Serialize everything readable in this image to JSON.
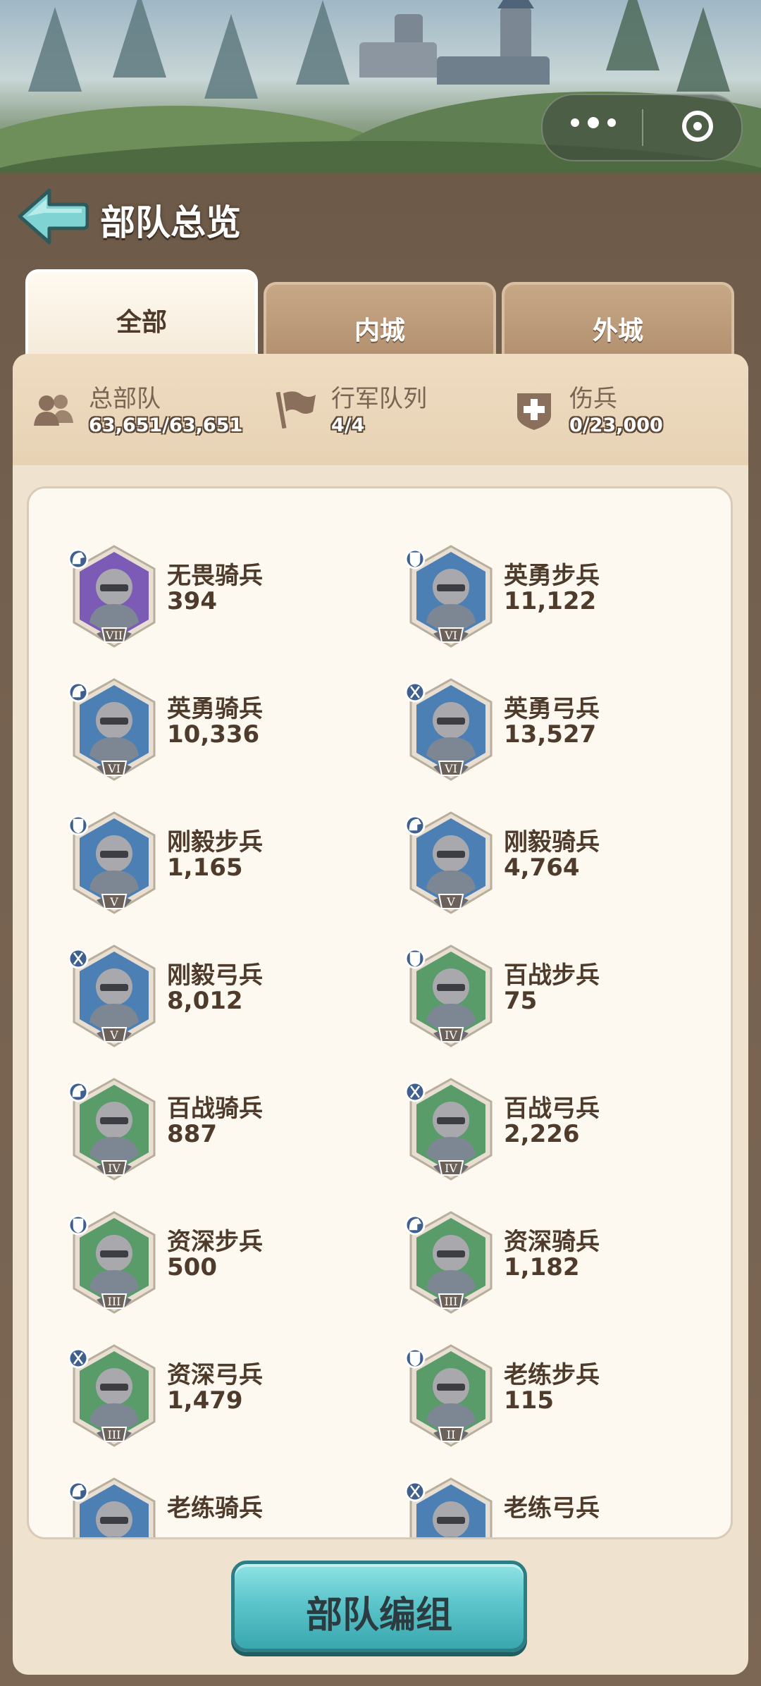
{
  "header": {
    "title": "部队总览"
  },
  "tabs": [
    {
      "label": "全部",
      "active": true
    },
    {
      "label": "内城",
      "active": false
    },
    {
      "label": "外城",
      "active": false
    }
  ],
  "stats": [
    {
      "label": "总部队",
      "value": "63,651/63,651",
      "icon": "troops-icon"
    },
    {
      "label": "行军队列",
      "value": "4/4",
      "icon": "flag-icon"
    },
    {
      "label": "伤兵",
      "value": "0/23,000",
      "icon": "wounded-icon"
    }
  ],
  "units": [
    {
      "name": "无畏骑兵",
      "count": "394",
      "tier": "VII",
      "type": "cavalry",
      "bg": "#7b5bb5"
    },
    {
      "name": "英勇步兵",
      "count": "11,122",
      "tier": "VI",
      "type": "infantry",
      "bg": "#4c7fb4"
    },
    {
      "name": "英勇骑兵",
      "count": "10,336",
      "tier": "VI",
      "type": "cavalry",
      "bg": "#4c7fb4"
    },
    {
      "name": "英勇弓兵",
      "count": "13,527",
      "tier": "VI",
      "type": "archer",
      "bg": "#4c7fb4"
    },
    {
      "name": "刚毅步兵",
      "count": "1,165",
      "tier": "V",
      "type": "infantry",
      "bg": "#4c7fb4"
    },
    {
      "name": "刚毅骑兵",
      "count": "4,764",
      "tier": "V",
      "type": "cavalry",
      "bg": "#4c7fb4"
    },
    {
      "name": "刚毅弓兵",
      "count": "8,012",
      "tier": "V",
      "type": "archer",
      "bg": "#4c7fb4"
    },
    {
      "name": "百战步兵",
      "count": "75",
      "tier": "IV",
      "type": "infantry",
      "bg": "#5a9b6a"
    },
    {
      "name": "百战骑兵",
      "count": "887",
      "tier": "IV",
      "type": "cavalry",
      "bg": "#5a9b6a"
    },
    {
      "name": "百战弓兵",
      "count": "2,226",
      "tier": "IV",
      "type": "archer",
      "bg": "#5a9b6a"
    },
    {
      "name": "资深步兵",
      "count": "500",
      "tier": "III",
      "type": "infantry",
      "bg": "#5a9b6a"
    },
    {
      "name": "资深骑兵",
      "count": "1,182",
      "tier": "III",
      "type": "cavalry",
      "bg": "#5a9b6a"
    },
    {
      "name": "资深弓兵",
      "count": "1,479",
      "tier": "III",
      "type": "archer",
      "bg": "#5a9b6a"
    },
    {
      "name": "老练步兵",
      "count": "115",
      "tier": "II",
      "type": "infantry",
      "bg": "#5a9b6a"
    },
    {
      "name": "老练骑兵",
      "count": "",
      "tier": "",
      "type": "cavalry",
      "bg": "#4c7fb4"
    },
    {
      "name": "老练弓兵",
      "count": "",
      "tier": "",
      "type": "archer",
      "bg": "#4c7fb4"
    }
  ],
  "cta": {
    "label": "部队编组"
  },
  "colors": {
    "accent": "#5cc6cc",
    "panel": "#efe3cf",
    "text": "#4f3b2c"
  }
}
